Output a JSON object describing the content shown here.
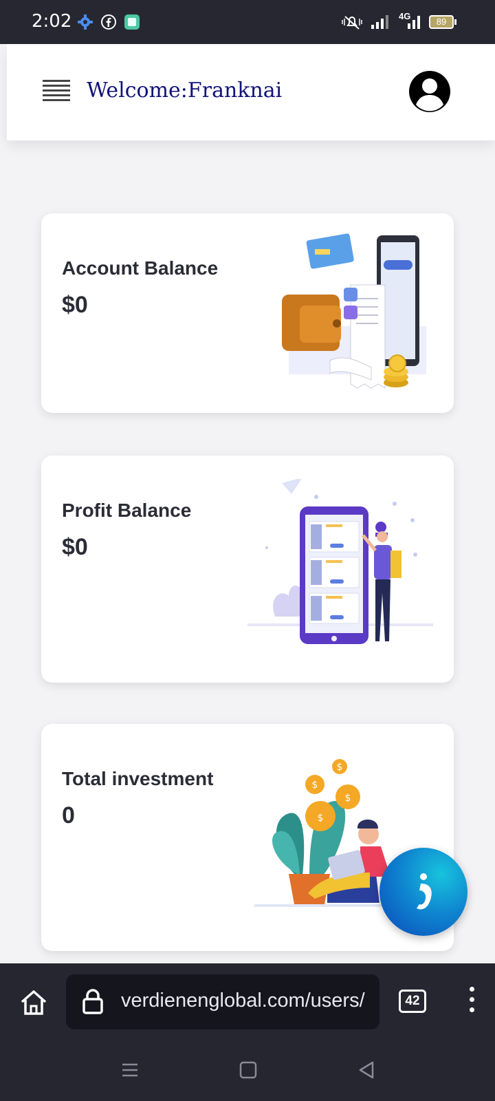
{
  "status_bar": {
    "time": "2:02",
    "network": "4G",
    "battery": "89",
    "icons": [
      "settings-gear-icon",
      "facebook-icon",
      "app-notification-icon",
      "mute-bell-icon",
      "signal-icon",
      "signal-4g-icon",
      "battery-icon"
    ]
  },
  "header": {
    "welcome_text": "Welcome:Franknai",
    "menu_icon": "hamburger-menu-icon",
    "profile_icon": "user-avatar-icon"
  },
  "cards": [
    {
      "title": "Account Balance",
      "value": "$0",
      "illustration": "wallet-payment-illustration"
    },
    {
      "title": "Profit Balance",
      "value": "$0",
      "illustration": "phone-shopping-person-illustration"
    },
    {
      "title": "Total investment",
      "value": "0",
      "illustration": "person-laptop-coins-illustration"
    }
  ],
  "chat_fab": {
    "icon": "chat-bubble-icon"
  },
  "browser": {
    "url": "verdienenglobal.com/users/",
    "tab_count": "42",
    "icons": [
      "home-icon",
      "lock-icon",
      "tabs-icon",
      "more-vert-icon"
    ]
  },
  "system_nav": {
    "icons": [
      "recents-icon",
      "home-square-icon",
      "back-icon"
    ]
  },
  "colors": {
    "status_bar_bg": "#272731",
    "welcome_text": "#12127a",
    "card_text": "#2c2c36",
    "chat_fab": "#0f86d0",
    "browser_bg": "#262631"
  }
}
